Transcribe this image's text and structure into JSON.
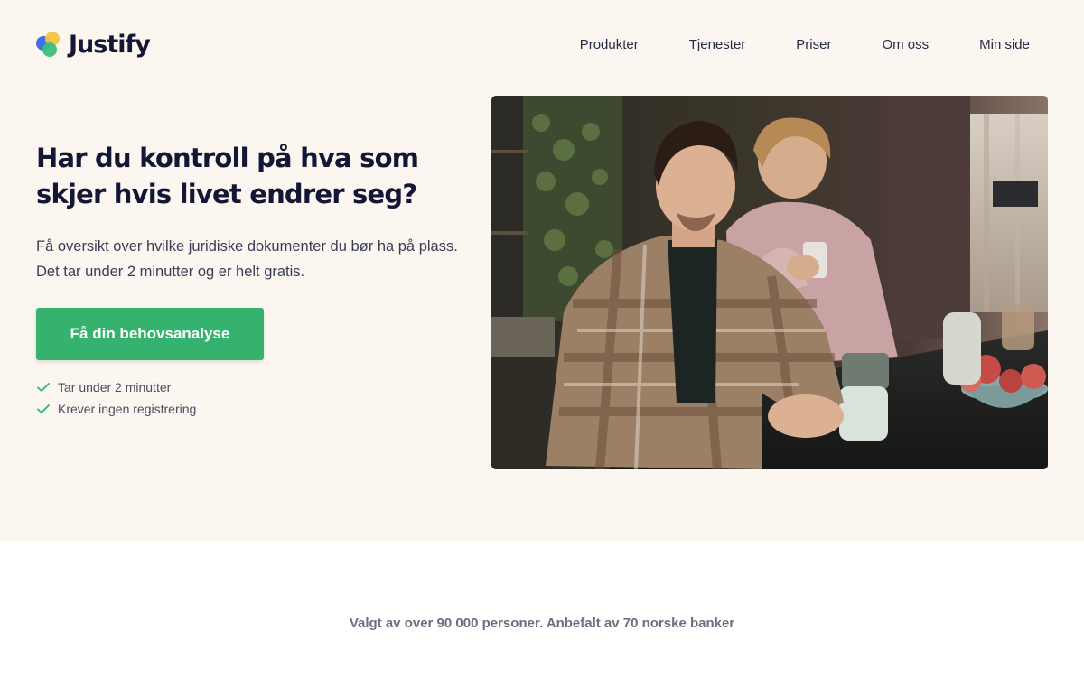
{
  "brand": {
    "name": "Justify"
  },
  "nav": {
    "items": [
      {
        "label": "Produkter"
      },
      {
        "label": "Tjenester"
      },
      {
        "label": "Priser"
      },
      {
        "label": "Om oss"
      },
      {
        "label": "Min side"
      }
    ]
  },
  "hero": {
    "headline": "Har du kontroll på hva som skjer hvis livet endrer seg?",
    "lead": "Få oversikt over hvilke juridiske dokumenter du bør ha på plass. Det tar under 2 minutter og er helt gratis.",
    "cta_label": "Få din behovsanalyse",
    "checks": [
      {
        "label": "Tar under 2 minutter",
        "icon": "check-icon"
      },
      {
        "label": "Krever ingen registrering",
        "icon": "check-icon"
      }
    ],
    "image": "couple-at-kitchen-table-photo"
  },
  "trust": {
    "text": "Valgt av over 90 000 personer. Anbefalt av 70 norske banker"
  },
  "colors": {
    "hero_bg": "#fcf6f0",
    "accent": "#34b26e",
    "text_dark": "#131634"
  }
}
